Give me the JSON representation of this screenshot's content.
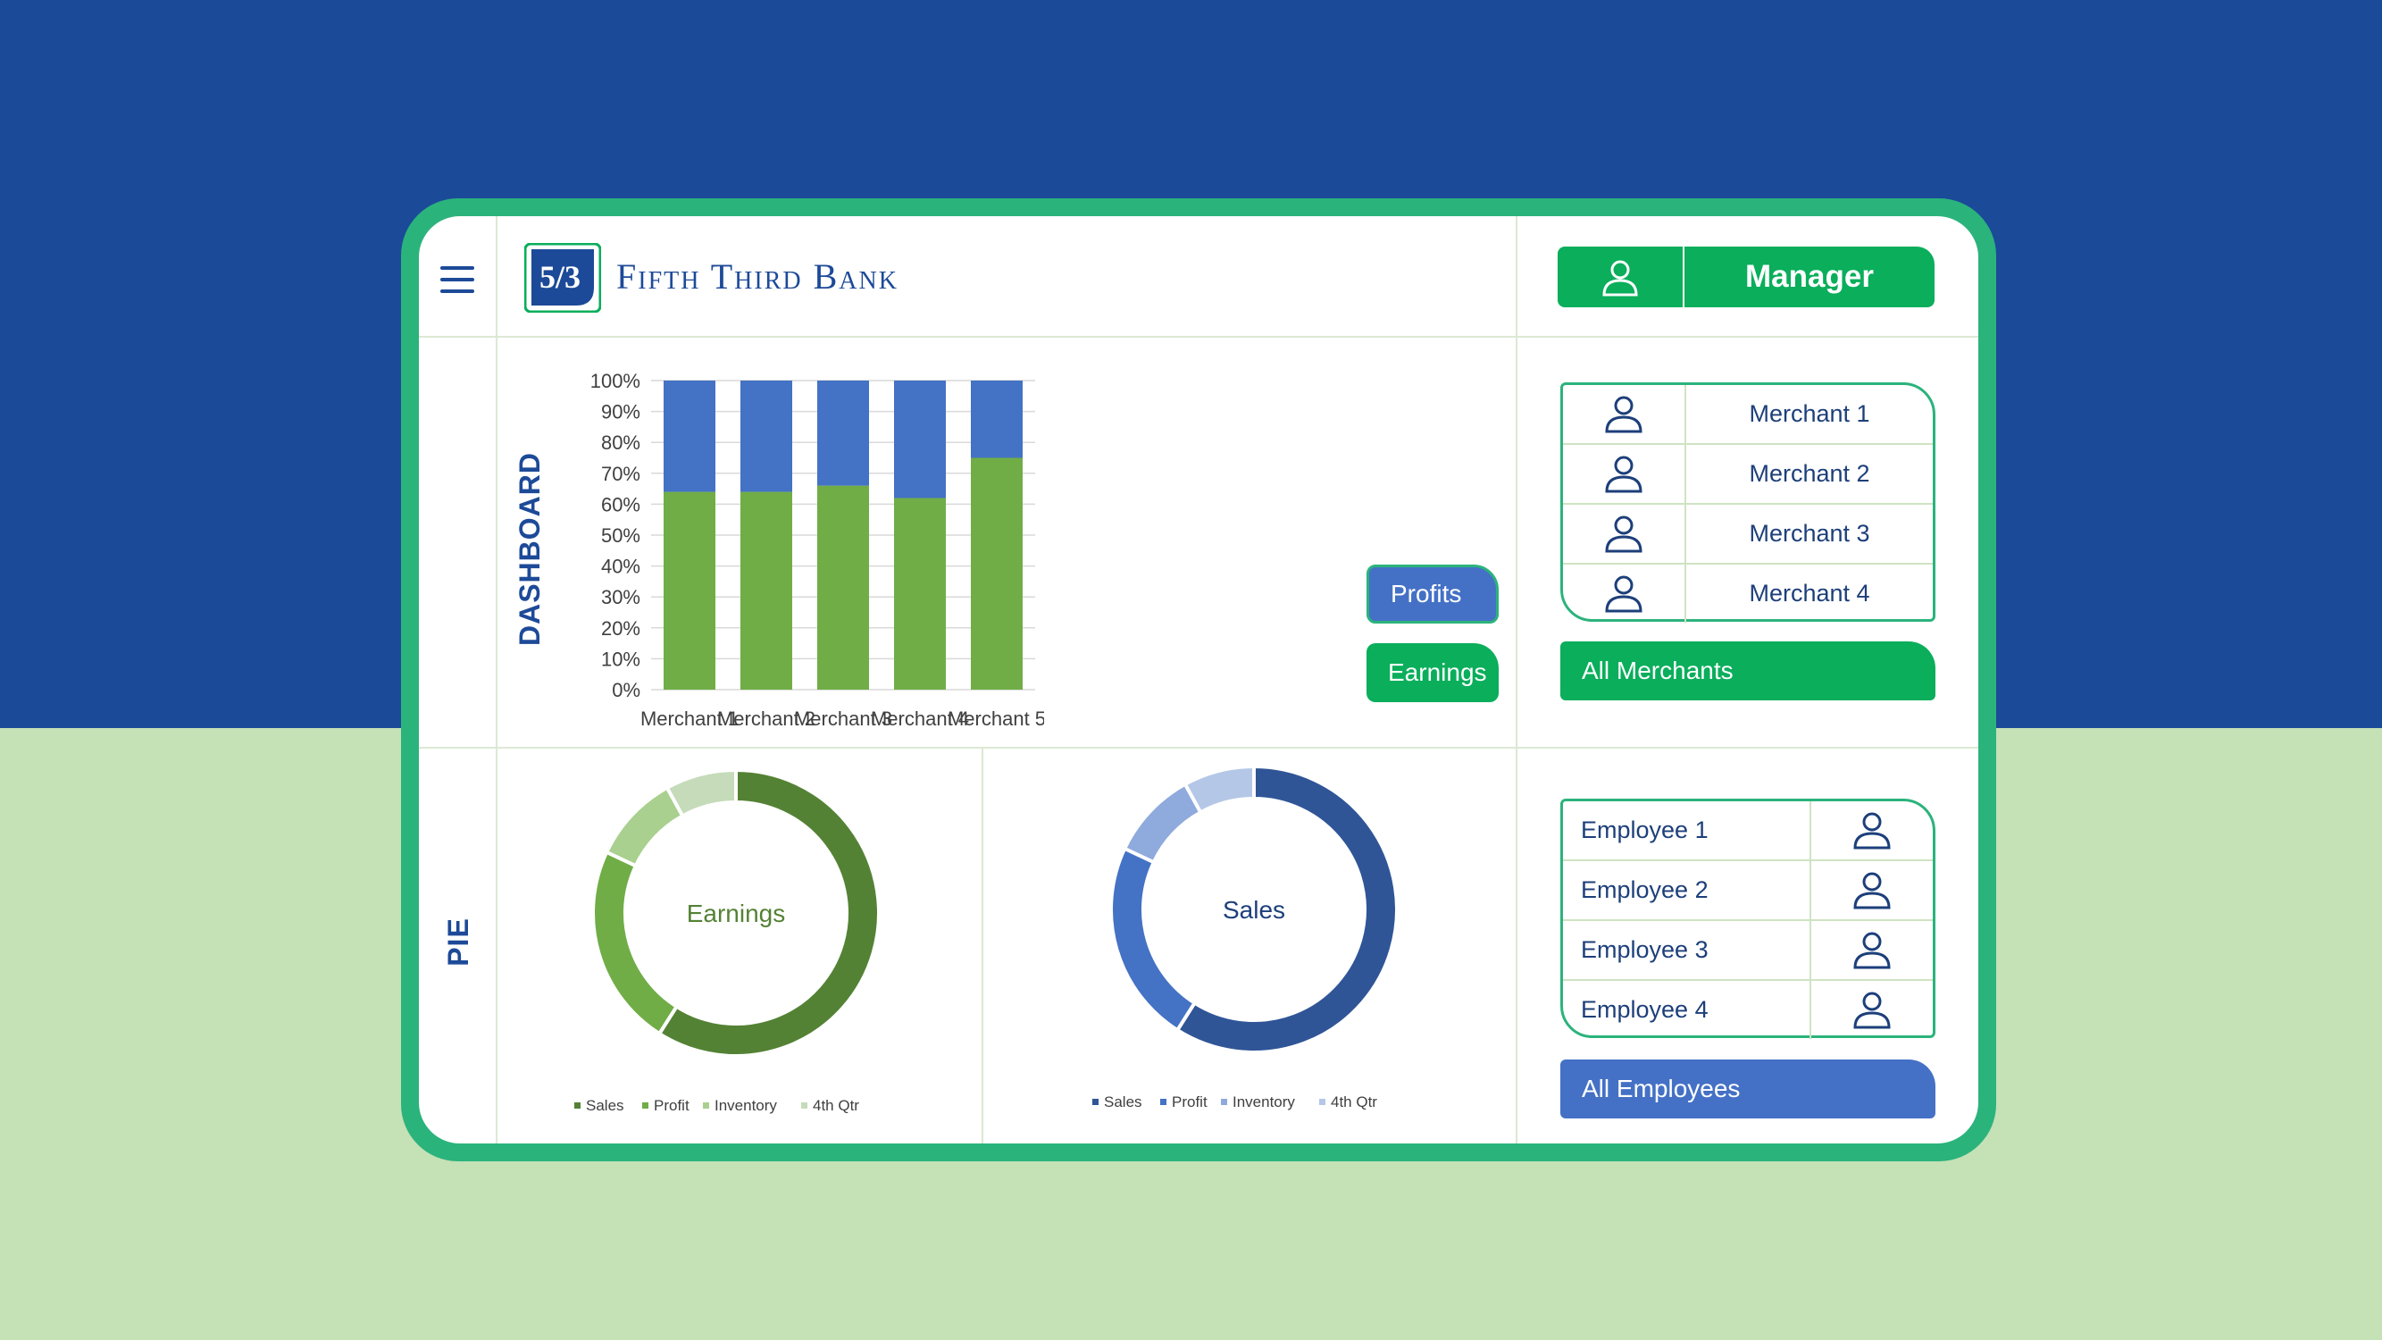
{
  "header": {
    "brand_name": "Fifth Third Bank",
    "logo_text": "5/3",
    "manager_label": "Manager"
  },
  "sidebar": {
    "dashboard_label": "DASHBOARD",
    "pie_label": "PIE"
  },
  "buttons": {
    "profits": "Profits",
    "earnings": "Earnings",
    "all_merchants": "All Merchants",
    "all_employees": "All Employees"
  },
  "merchants": [
    {
      "label": "Merchant 1"
    },
    {
      "label": "Merchant 2"
    },
    {
      "label": "Merchant 3"
    },
    {
      "label": "Merchant 4"
    }
  ],
  "employees": [
    {
      "label": "Employee 1"
    },
    {
      "label": "Employee 2"
    },
    {
      "label": "Employee 3"
    },
    {
      "label": "Employee 4"
    }
  ],
  "colors": {
    "bg_top": "#1b4a99",
    "bg_bottom": "#c5e1b6",
    "frame": "#2bb37c",
    "green": "#0aae5b",
    "blue": "#4471c6",
    "brand_blue": "#1d4a98",
    "bar_green": "#70ad47",
    "bar_blue": "#4472c4"
  },
  "icons": {
    "menu": "hamburger-icon",
    "user": "user-icon",
    "logo": "fifth-third-logo"
  },
  "chart_data": [
    {
      "type": "bar",
      "stacked": true,
      "percent": true,
      "categories": [
        "Merchant 1",
        "Merchant 2",
        "Merchant 3",
        "Merchant 4",
        "Merchant 5"
      ],
      "series": [
        {
          "values": [
            64,
            64,
            66,
            62,
            75
          ],
          "color": "#70ad47"
        },
        {
          "values": [
            36,
            36,
            34,
            38,
            25
          ],
          "color": "#4472c4"
        }
      ],
      "yticks": [
        "0%",
        "10%",
        "20%",
        "30%",
        "40%",
        "50%",
        "60%",
        "70%",
        "80%",
        "90%",
        "100%"
      ],
      "ylim": [
        0,
        100
      ],
      "grid": true
    },
    {
      "type": "pie",
      "donut": true,
      "center_label": "Earnings",
      "labels": [
        "Sales",
        "Profit",
        "Inventory",
        "4th Qtr"
      ],
      "values": [
        59,
        23,
        10,
        8
      ],
      "colors": [
        "#548235",
        "#70ad47",
        "#a9d08e",
        "#c5dbb9"
      ],
      "legend": "bottom"
    },
    {
      "type": "pie",
      "donut": true,
      "center_label": "Sales",
      "labels": [
        "Sales",
        "Profit",
        "Inventory",
        "4th Qtr"
      ],
      "values": [
        59,
        23,
        10,
        8
      ],
      "colors": [
        "#2f5597",
        "#4472c4",
        "#8faadc",
        "#b4c7e7"
      ],
      "legend": "bottom"
    }
  ]
}
